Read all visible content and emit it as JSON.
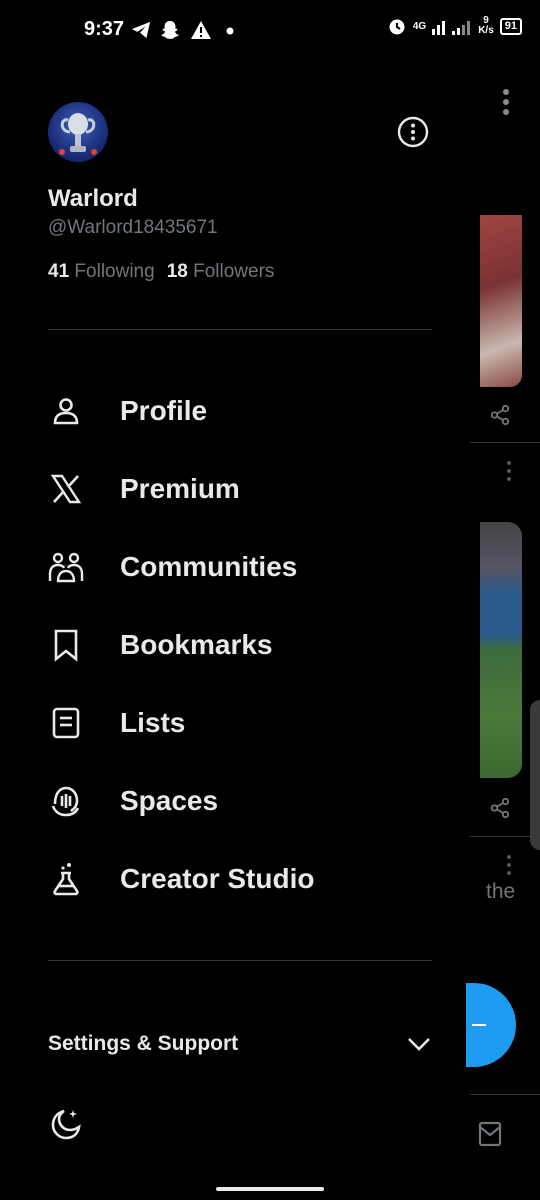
{
  "status_bar": {
    "time": "9:37",
    "network": "4G",
    "speed_value": "9",
    "speed_unit": "K/s",
    "battery": "91"
  },
  "profile": {
    "name": "Warlord",
    "handle": "@Warlord18435671",
    "following_count": "41",
    "following_label": "Following",
    "followers_count": "18",
    "followers_label": "Followers"
  },
  "menu": {
    "items": [
      {
        "label": "Profile",
        "icon": "person-icon"
      },
      {
        "label": "Premium",
        "icon": "x-logo-icon"
      },
      {
        "label": "Communities",
        "icon": "communities-icon"
      },
      {
        "label": "Bookmarks",
        "icon": "bookmark-icon"
      },
      {
        "label": "Lists",
        "icon": "lists-icon"
      },
      {
        "label": "Spaces",
        "icon": "spaces-icon"
      },
      {
        "label": "Creator Studio",
        "icon": "flask-icon"
      }
    ]
  },
  "settings": {
    "label": "Settings & Support"
  },
  "background_feed": {
    "partial_text": "the"
  },
  "colors": {
    "background": "#000000",
    "text_primary": "#e7e9ea",
    "text_secondary": "#71767b",
    "divider": "#2f3336",
    "accent": "#1d9bf0"
  }
}
